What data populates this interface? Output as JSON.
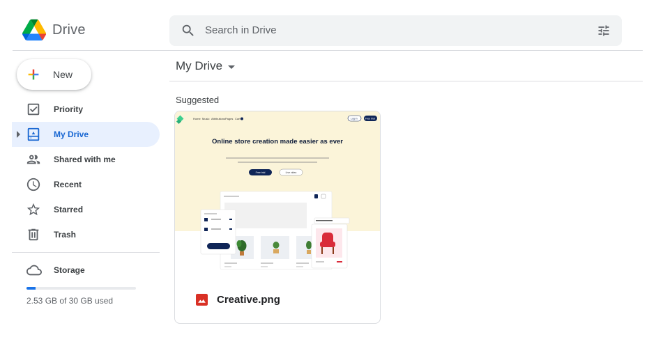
{
  "app": {
    "name": "Drive"
  },
  "search": {
    "placeholder": "Search in Drive",
    "icon": "search-icon",
    "filter_icon": "tune-icon"
  },
  "new_button": {
    "label": "New"
  },
  "sidebar": {
    "items": [
      {
        "label": "Priority",
        "icon": "priority-check-icon",
        "active": false
      },
      {
        "label": "My Drive",
        "icon": "my-drive-icon",
        "active": true
      },
      {
        "label": "Shared with me",
        "icon": "shared-people-icon",
        "active": false
      },
      {
        "label": "Recent",
        "icon": "clock-icon",
        "active": false
      },
      {
        "label": "Starred",
        "icon": "star-icon",
        "active": false
      },
      {
        "label": "Trash",
        "icon": "trash-icon",
        "active": false
      }
    ],
    "storage": {
      "label": "Storage",
      "icon": "cloud-icon",
      "used_text": "2.53 GB of 30 GB used",
      "used_fraction": 0.084
    }
  },
  "main": {
    "breadcrumb": "My Drive",
    "section_title": "Suggested",
    "files": [
      {
        "name": "Creative.png",
        "type_icon": "image-file-icon",
        "preview": {
          "nav": [
            "Home",
            "Music",
            "Attributions",
            "Pages",
            "Cart"
          ],
          "buttons": [
            "Log in",
            "Free trial"
          ],
          "headline": "Online store creation made easier as ever",
          "cta": [
            "Free trial",
            "Live video"
          ]
        }
      }
    ]
  },
  "colors": {
    "accent": "#1a73e8",
    "active_bg": "#e8f0fe",
    "active_text": "#1967d2",
    "thumb_bg": "#fbf4d9"
  }
}
